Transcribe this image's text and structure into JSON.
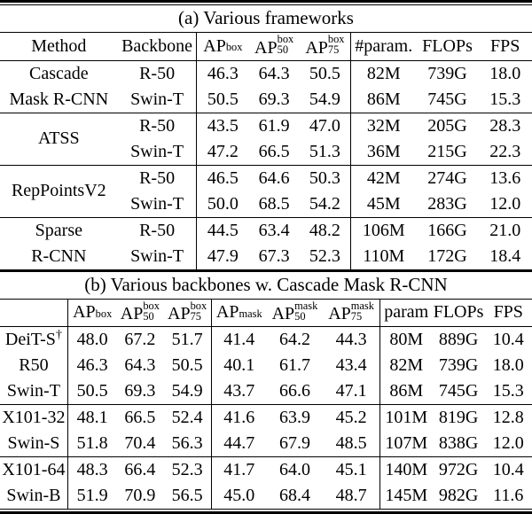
{
  "table_a": {
    "caption": "(a) Various frameworks",
    "headers": {
      "method": "Method",
      "backbone": "Backbone",
      "ap_box": {
        "base": "AP",
        "sup": "box",
        "sub": ""
      },
      "ap_box_50": {
        "base": "AP",
        "sup": "box",
        "sub": "50"
      },
      "ap_box_75": {
        "base": "AP",
        "sup": "box",
        "sub": "75"
      },
      "params": "#param.",
      "flops": "FLOPs",
      "fps": "FPS"
    },
    "groups": [
      {
        "method": "Cascade\nMask R-CNN",
        "method_line1": "Cascade",
        "method_line2": "Mask R-CNN",
        "rows": [
          {
            "backbone": "R-50",
            "ap": "46.3",
            "ap50": "64.3",
            "ap75": "50.5",
            "params": "82M",
            "flops": "739G",
            "fps": "18.0",
            "bold": false
          },
          {
            "backbone": "Swin-T",
            "ap": "50.5",
            "ap50": "69.3",
            "ap75": "54.9",
            "params": "86M",
            "flops": "745G",
            "fps": "15.3",
            "bold": true
          }
        ]
      },
      {
        "method_line1": "",
        "method_line2": "ATSS",
        "rows": [
          {
            "backbone": "R-50",
            "ap": "43.5",
            "ap50": "61.9",
            "ap75": "47.0",
            "params": "32M",
            "flops": "205G",
            "fps": "28.3",
            "bold": false
          },
          {
            "backbone": "Swin-T",
            "ap": "47.2",
            "ap50": "66.5",
            "ap75": "51.3",
            "params": "36M",
            "flops": "215G",
            "fps": "22.3",
            "bold": true
          }
        ]
      },
      {
        "method_line1": "",
        "method_line2": "RepPointsV2",
        "rows": [
          {
            "backbone": "R-50",
            "ap": "46.5",
            "ap50": "64.6",
            "ap75": "50.3",
            "params": "42M",
            "flops": "274G",
            "fps": "13.6",
            "bold": false
          },
          {
            "backbone": "Swin-T",
            "ap": "50.0",
            "ap50": "68.5",
            "ap75": "54.2",
            "params": "45M",
            "flops": "283G",
            "fps": "12.0",
            "bold": true
          }
        ]
      },
      {
        "method_line1": "Sparse",
        "method_line2": "R-CNN",
        "rows": [
          {
            "backbone": "R-50",
            "ap": "44.5",
            "ap50": "63.4",
            "ap75": "48.2",
            "params": "106M",
            "flops": "166G",
            "fps": "21.0",
            "bold": false
          },
          {
            "backbone": "Swin-T",
            "ap": "47.9",
            "ap50": "67.3",
            "ap75": "52.3",
            "params": "110M",
            "flops": "172G",
            "fps": "18.4",
            "bold": true
          }
        ]
      }
    ]
  },
  "table_b": {
    "caption": "(b) Various backbones w. Cascade Mask R-CNN",
    "headers": {
      "backbone": "",
      "ap_box": {
        "base": "AP",
        "sup": "box",
        "sub": ""
      },
      "ap_box_50": {
        "base": "AP",
        "sup": "box",
        "sub": "50"
      },
      "ap_box_75": {
        "base": "AP",
        "sup": "box",
        "sub": "75"
      },
      "ap_mask": {
        "base": "AP",
        "sup": "mask",
        "sub": ""
      },
      "ap_mask_50": {
        "base": "AP",
        "sup": "mask",
        "sub": "50"
      },
      "ap_mask_75": {
        "base": "AP",
        "sup": "mask",
        "sub": "75"
      },
      "params": "param",
      "flops": "FLOPs",
      "fps": "FPS"
    },
    "groups": [
      {
        "rows": [
          {
            "backbone": "DeiT-S",
            "dagger": "†",
            "apb": "48.0",
            "apb50": "67.2",
            "apb75": "51.7",
            "apm": "41.4",
            "apm50": "64.2",
            "apm75": "44.3",
            "params": "80M",
            "flops": "889G",
            "fps": "10.4",
            "bold": false
          },
          {
            "backbone": "R50",
            "dagger": "",
            "apb": "46.3",
            "apb50": "64.3",
            "apb75": "50.5",
            "apm": "40.1",
            "apm50": "61.7",
            "apm75": "43.4",
            "params": "82M",
            "flops": "739G",
            "fps": "18.0",
            "bold": false
          },
          {
            "backbone": "Swin-T",
            "dagger": "",
            "apb": "50.5",
            "apb50": "69.3",
            "apb75": "54.9",
            "apm": "43.7",
            "apm50": "66.6",
            "apm75": "47.1",
            "params": "86M",
            "flops": "745G",
            "fps": "15.3",
            "bold": true
          }
        ]
      },
      {
        "rows": [
          {
            "backbone": "X101-32",
            "dagger": "",
            "apb": "48.1",
            "apb50": "66.5",
            "apb75": "52.4",
            "apm": "41.6",
            "apm50": "63.9",
            "apm75": "45.2",
            "params": "101M",
            "flops": "819G",
            "fps": "12.8",
            "bold": false
          },
          {
            "backbone": "Swin-S",
            "dagger": "",
            "apb": "51.8",
            "apb50": "70.4",
            "apb75": "56.3",
            "apm": "44.7",
            "apm50": "67.9",
            "apm75": "48.5",
            "params": "107M",
            "flops": "838G",
            "fps": "12.0",
            "bold": true
          }
        ]
      },
      {
        "rows": [
          {
            "backbone": "X101-64",
            "dagger": "",
            "apb": "48.3",
            "apb50": "66.4",
            "apb75": "52.3",
            "apm": "41.7",
            "apm50": "64.0",
            "apm75": "45.1",
            "params": "140M",
            "flops": "972G",
            "fps": "10.4",
            "bold": false
          },
          {
            "backbone": "Swin-B",
            "dagger": "",
            "apb": "51.9",
            "apb50": "70.9",
            "apb75": "56.5",
            "apm": "45.0",
            "apm50": "68.4",
            "apm75": "48.7",
            "params": "145M",
            "flops": "982G",
            "fps": "11.6",
            "bold": true
          }
        ]
      }
    ]
  }
}
